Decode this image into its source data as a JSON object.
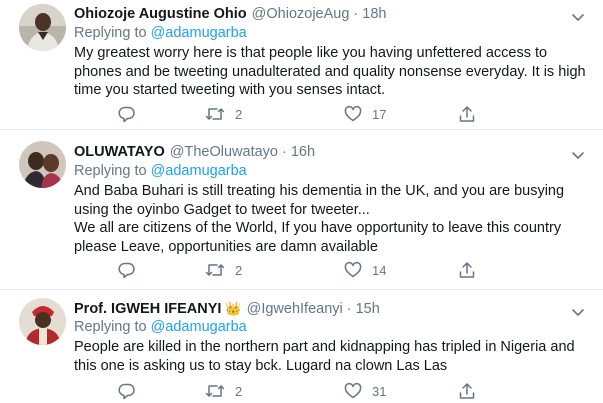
{
  "tweets": [
    {
      "name": "Ohiozoje Augustine Ohio",
      "badge": "",
      "handle": "@OhiozojeAug",
      "separator": "·",
      "time": "18h",
      "replying_prefix": "Replying to",
      "replying_to": "@adamugarba",
      "text": "My greatest worry here is that people like you having unfettered access to phones and be tweeting unadulterated and quality nonsense everyday. It is high time you started tweeting with you senses intact.",
      "reply_count": "",
      "retweet_count": "2",
      "like_count": "17",
      "icons": {
        "reply": "reply-icon",
        "retweet": "retweet-icon",
        "like": "heart-icon",
        "share": "share-icon",
        "menu": "chevron-down-icon"
      }
    },
    {
      "name": "OLUWATAYO",
      "badge": "",
      "handle": "@TheOluwatayo",
      "separator": "·",
      "time": "16h",
      "replying_prefix": "Replying to",
      "replying_to": "@adamugarba",
      "text": "And Baba Buhari is still treating his dementia in the UK, and you are busying using the oyinbo Gadget to tweet for tweeter...\nWe all are citizens of the World, If you have opportunity to leave this country please Leave, opportunities are damn available",
      "reply_count": "",
      "retweet_count": "2",
      "like_count": "14",
      "icons": {
        "reply": "reply-icon",
        "retweet": "retweet-icon",
        "like": "heart-icon",
        "share": "share-icon",
        "menu": "chevron-down-icon"
      }
    },
    {
      "name": "Prof. IGWEH IFEANYI",
      "badge": "👑",
      "handle": "@IgwehIfeanyi",
      "separator": "·",
      "time": "15h",
      "replying_prefix": "Replying to",
      "replying_to": "@adamugarba",
      "text": "People are killed in the northern part and kidnapping has tripled in Nigeria and this one is asking us to stay bck. Lugard na clown Las Las",
      "reply_count": "",
      "retweet_count": "2",
      "like_count": "31",
      "icons": {
        "reply": "reply-icon",
        "retweet": "retweet-icon",
        "like": "heart-icon",
        "share": "share-icon",
        "menu": "chevron-down-icon"
      }
    }
  ],
  "colors": {
    "text": "#14171a",
    "muted": "#657786",
    "link": "#1da1f2",
    "border": "#e6ecf0"
  }
}
